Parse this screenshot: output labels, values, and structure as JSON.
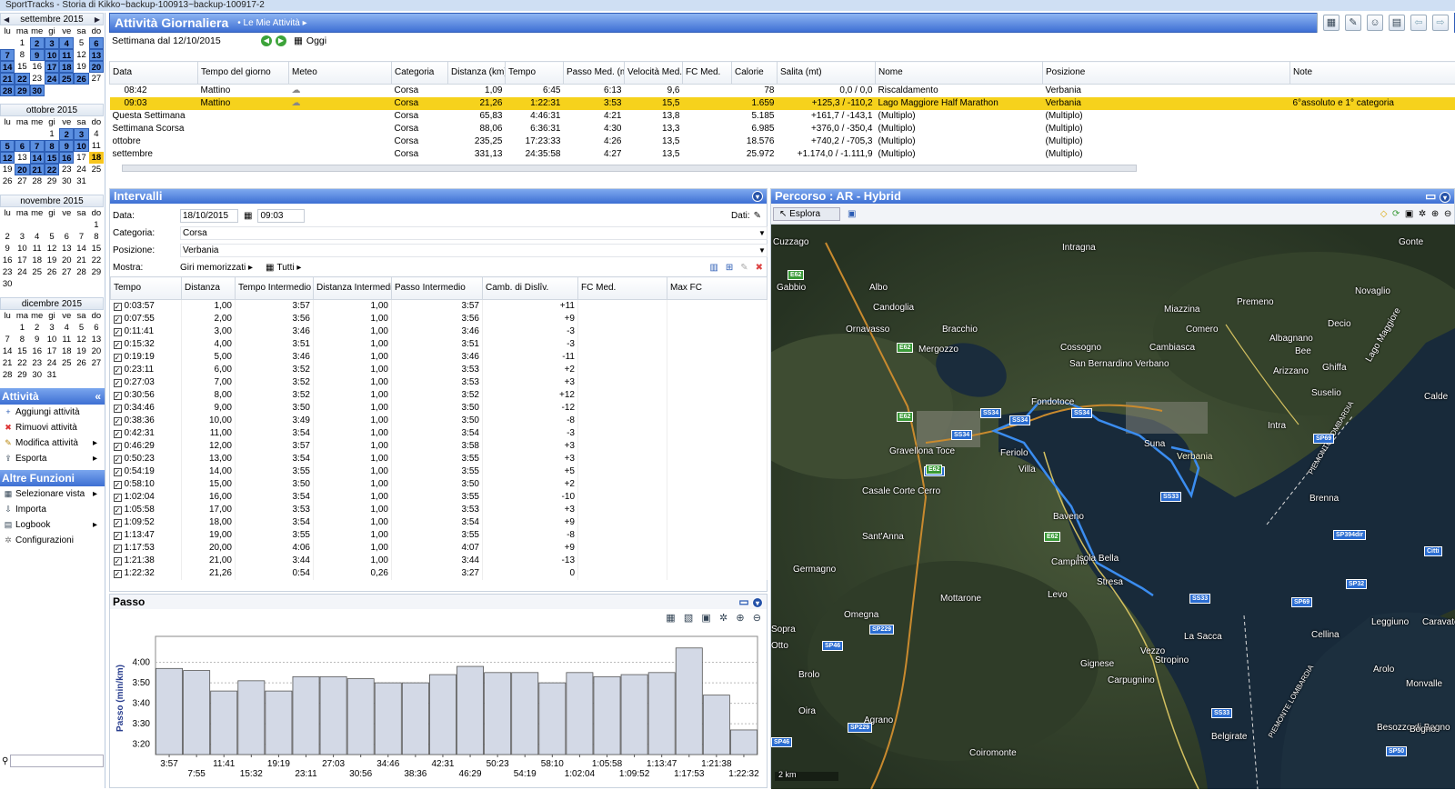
{
  "window_title": "SportTracks - Storia di Kikko~backup-100913~backup-100917-2",
  "calendars": [
    {
      "month": "settembre 2015",
      "days": [
        "",
        "1",
        "2",
        "3",
        "4",
        "5",
        "6",
        "7",
        "8",
        "9",
        "10",
        "11",
        "12",
        "13",
        "14",
        "15",
        "16",
        "17",
        "18",
        "19",
        "20",
        "21",
        "22",
        "23",
        "24",
        "25",
        "26",
        "27",
        "28",
        "29",
        "30"
      ],
      "highlight": [
        "2",
        "3",
        "4",
        "6",
        "7",
        "9",
        "10",
        "11",
        "13",
        "14",
        "17",
        "18",
        "20",
        "21",
        "22",
        "24",
        "25",
        "26",
        "28",
        "29",
        "30"
      ],
      "today": ""
    },
    {
      "month": "ottobre 2015",
      "days": [
        "",
        "",
        "",
        "1",
        "2",
        "3",
        "4",
        "5",
        "6",
        "7",
        "8",
        "9",
        "10",
        "11",
        "12",
        "13",
        "14",
        "15",
        "16",
        "17",
        "18",
        "19",
        "20",
        "21",
        "22",
        "23",
        "24",
        "25",
        "26",
        "27",
        "28",
        "29",
        "30",
        "31"
      ],
      "highlight": [
        "2",
        "3",
        "5",
        "6",
        "7",
        "8",
        "9",
        "10",
        "12",
        "14",
        "15",
        "16",
        "20",
        "21",
        "22"
      ],
      "today": "18"
    },
    {
      "month": "novembre 2015",
      "days": [
        "",
        "",
        "",
        "",
        "",
        "",
        "1",
        "2",
        "3",
        "4",
        "5",
        "6",
        "7",
        "8",
        "9",
        "10",
        "11",
        "12",
        "13",
        "14",
        "15",
        "16",
        "17",
        "18",
        "19",
        "20",
        "21",
        "22",
        "23",
        "24",
        "25",
        "26",
        "27",
        "28",
        "29",
        "30"
      ],
      "highlight": [],
      "today": ""
    },
    {
      "month": "dicembre 2015",
      "days": [
        "",
        "1",
        "2",
        "3",
        "4",
        "5",
        "6",
        "7",
        "8",
        "9",
        "10",
        "11",
        "12",
        "13",
        "14",
        "15",
        "16",
        "17",
        "18",
        "19",
        "20",
        "21",
        "22",
        "23",
        "24",
        "25",
        "26",
        "27",
        "28",
        "29",
        "30",
        "31"
      ],
      "highlight": [],
      "today": ""
    }
  ],
  "weekdays": [
    "lu",
    "ma",
    "me",
    "gi",
    "ve",
    "sa",
    "do"
  ],
  "sidebar": {
    "attivita_title": "Attività Giornaliera",
    "attivita_items": [
      {
        "label": "Aggiungi attività",
        "icon": "add-icon"
      },
      {
        "label": "Rimuovi attività",
        "icon": "remove-icon"
      },
      {
        "label": "Modifica attività",
        "icon": "edit-icon"
      },
      {
        "label": "Esporta",
        "icon": "export-icon"
      }
    ],
    "altre_title": "Altre Funzioni",
    "altre_items": [
      {
        "label": "Selezionare vista",
        "icon": "view-icon"
      },
      {
        "label": "Importa",
        "icon": "import-icon"
      },
      {
        "label": "Logbook",
        "icon": "logbook-icon"
      },
      {
        "label": "Configurazioni",
        "icon": "gear-icon"
      }
    ]
  },
  "header": {
    "title": "Attività Giornaliera",
    "subtitle": "Le Mie Attività",
    "week": "Settimana dal 12/10/2015",
    "today_label": "Oggi"
  },
  "activities": {
    "columns": [
      "Data",
      "Tempo del giorno",
      "Meteo",
      "Categoria",
      "Distanza (km)",
      "Tempo",
      "Passo Med. (min/km)",
      "Velocità Med. (kph)",
      "FC Med.",
      "Calorie",
      "Salita (mt)",
      "Nome",
      "Posizione",
      "Note"
    ],
    "rows": [
      [
        "08:42",
        "Mattino",
        "",
        "Corsa",
        "1,09",
        "6:45",
        "6:13",
        "9,6",
        "",
        "78",
        "0,0 / 0,0",
        "Riscaldamento",
        "Verbania",
        ""
      ],
      [
        "09:03",
        "Mattino",
        "",
        "Corsa",
        "21,26",
        "1:22:31",
        "3:53",
        "15,5",
        "",
        "1.659",
        "+125,3 / -110,2",
        "Lago Maggiore Half Marathon",
        "Verbania",
        "6°assoluto e 1° categoria"
      ],
      [
        "Questa Settimana",
        "",
        "",
        "Corsa",
        "65,83",
        "4:46:31",
        "4:21",
        "13,8",
        "",
        "5.185",
        "+161,7 / -143,1",
        "(Multiplo)",
        "(Multiplo)",
        ""
      ],
      [
        "Settimana Scorsa",
        "",
        "",
        "Corsa",
        "88,06",
        "6:36:31",
        "4:30",
        "13,3",
        "",
        "6.985",
        "+376,0 / -350,4",
        "(Multiplo)",
        "(Multiplo)",
        ""
      ],
      [
        "ottobre",
        "",
        "",
        "Corsa",
        "235,25",
        "17:23:33",
        "4:26",
        "13,5",
        "",
        "18.576",
        "+740,2 / -705,3",
        "(Multiplo)",
        "(Multiplo)",
        ""
      ],
      [
        "settembre",
        "",
        "",
        "Corsa",
        "331,13",
        "24:35:58",
        "4:27",
        "13,5",
        "",
        "25.972",
        "+1.174,0 / -1.111,9",
        "(Multiplo)",
        "(Multiplo)",
        ""
      ]
    ]
  },
  "intervals": {
    "title": "Intervalli",
    "data_label": "Data:",
    "date": "18/10/2015",
    "time": "09:03",
    "dati_label": "Dati:",
    "categoria_label": "Categoria:",
    "categoria": "Corsa",
    "posizione_label": "Posizione:",
    "posizione": "Verbania",
    "mostra_label": "Mostra:",
    "mostra_value": "Giri memorizzati",
    "tutti": "Tutti",
    "columns": [
      "Tempo",
      "Distanza",
      "Tempo Intermedio",
      "Distanza Intermedia",
      "Passo Intermedio",
      "Camb. di Dislîv.",
      "FC Med.",
      "Max FC"
    ],
    "rows": [
      [
        "0:03:57",
        "1,00",
        "3:57",
        "1,00",
        "3:57",
        "+11"
      ],
      [
        "0:07:55",
        "2,00",
        "3:56",
        "1,00",
        "3:56",
        "+9"
      ],
      [
        "0:11:41",
        "3,00",
        "3:46",
        "1,00",
        "3:46",
        "-3"
      ],
      [
        "0:15:32",
        "4,00",
        "3:51",
        "1,00",
        "3:51",
        "-3"
      ],
      [
        "0:19:19",
        "5,00",
        "3:46",
        "1,00",
        "3:46",
        "-11"
      ],
      [
        "0:23:11",
        "6,00",
        "3:52",
        "1,00",
        "3:53",
        "+2"
      ],
      [
        "0:27:03",
        "7,00",
        "3:52",
        "1,00",
        "3:53",
        "+3"
      ],
      [
        "0:30:56",
        "8,00",
        "3:52",
        "1,00",
        "3:52",
        "+12"
      ],
      [
        "0:34:46",
        "9,00",
        "3:50",
        "1,00",
        "3:50",
        "-12"
      ],
      [
        "0:38:36",
        "10,00",
        "3:49",
        "1,00",
        "3:50",
        "-8"
      ],
      [
        "0:42:31",
        "11,00",
        "3:54",
        "1,00",
        "3:54",
        "-3"
      ],
      [
        "0:46:29",
        "12,00",
        "3:57",
        "1,00",
        "3:58",
        "+3"
      ],
      [
        "0:50:23",
        "13,00",
        "3:54",
        "1,00",
        "3:55",
        "+3"
      ],
      [
        "0:54:19",
        "14,00",
        "3:55",
        "1,00",
        "3:55",
        "+5"
      ],
      [
        "0:58:10",
        "15,00",
        "3:50",
        "1,00",
        "3:50",
        "+2"
      ],
      [
        "1:02:04",
        "16,00",
        "3:54",
        "1,00",
        "3:55",
        "-10"
      ],
      [
        "1:05:58",
        "17,00",
        "3:53",
        "1,00",
        "3:53",
        "+3"
      ],
      [
        "1:09:52",
        "18,00",
        "3:54",
        "1,00",
        "3:54",
        "+9"
      ],
      [
        "1:13:47",
        "19,00",
        "3:55",
        "1,00",
        "3:55",
        "-8"
      ],
      [
        "1:17:53",
        "20,00",
        "4:06",
        "1,00",
        "4:07",
        "+9"
      ],
      [
        "1:21:38",
        "21,00",
        "3:44",
        "1,00",
        "3:44",
        "-13"
      ],
      [
        "1:22:32",
        "21,26",
        "0:54",
        "0,26",
        "3:27",
        "0"
      ]
    ]
  },
  "passo": {
    "title": "Passo"
  },
  "chart_data": {
    "type": "bar",
    "title": "Passo",
    "ylabel": "Passo (min/km)",
    "yticks": [
      "3:20",
      "3:30",
      "3:40",
      "3:50",
      "4:00"
    ],
    "ylim_seconds": [
      195,
      250
    ],
    "categories": [
      "3:57",
      "7:55",
      "11:41",
      "15:32",
      "19:19",
      "23:11",
      "27:03",
      "30:56",
      "34:46",
      "38:36",
      "42:31",
      "46:29",
      "50:23",
      "54:19",
      "58:10",
      "1:02:04",
      "1:05:58",
      "1:09:52",
      "1:13:47",
      "1:17:53",
      "1:21:38",
      "1:22:32"
    ],
    "values": [
      "3:57",
      "3:56",
      "3:46",
      "3:51",
      "3:46",
      "3:53",
      "3:53",
      "3:52",
      "3:50",
      "3:50",
      "3:54",
      "3:58",
      "3:55",
      "3:55",
      "3:50",
      "3:55",
      "3:53",
      "3:54",
      "3:55",
      "4:07",
      "3:44",
      "3:27"
    ],
    "values_seconds": [
      237,
      236,
      226,
      231,
      226,
      233,
      233,
      232,
      230,
      230,
      234,
      238,
      235,
      235,
      230,
      235,
      233,
      234,
      235,
      247,
      224,
      207
    ]
  },
  "map": {
    "title": "Percorso : AR - Hybrid",
    "explore_label": "Esplora",
    "scale": "2 km",
    "places": [
      "Cuzzago",
      "Intragna",
      "Gonte",
      "Gabbio",
      "Albo",
      "Novaglio",
      "Candoglia",
      "Premeno",
      "Miazzina",
      "Ornavasso",
      "Bracchio",
      "Decio",
      "Mergozzo",
      "Comero",
      "Albagnano",
      "Cossogno",
      "Cambiasca",
      "Bee",
      "San Bernardino Verbano",
      "Arizzano",
      "Ghiffa",
      "Lago Maggiore",
      "Fondotoce",
      "Suselio",
      "Calde",
      "Intra",
      "Suna",
      "Verbania",
      "Gravellona Toce",
      "Feriolo",
      "Villa",
      "PIEMONTE LOMBARDIA",
      "Casale Corte Cerro",
      "Baveno",
      "Sant'Anna",
      "Brenna",
      "Campino",
      "Isola Bella",
      "Germagno",
      "Stresa",
      "Levo",
      "Omegna",
      "Mottarone",
      "Leggiuno",
      "Caravate",
      "Cellina",
      "Sopra",
      "Otto",
      "Vezzo",
      "La Sacca",
      "Brolo",
      "Gignese",
      "Stropino",
      "Arolo",
      "Carpugnino",
      "Monvalle",
      "Oira",
      "Agrano",
      "Belgirate",
      "Besozzo di Bogno",
      "Bogno",
      "Coiromonte",
      "PIEMONTE LOMBARDIA"
    ],
    "roads": [
      "E62",
      "E62",
      "E62",
      "SS34",
      "SS34",
      "SS34",
      "SS34",
      "SS33",
      "SS33",
      "E62",
      "SS33",
      "SP69",
      "SP394dir",
      "SP32",
      "SP69",
      "SP229",
      "SP46",
      "SP229",
      "E62",
      "SP50",
      "SP46",
      "SS33",
      "Citti"
    ]
  }
}
